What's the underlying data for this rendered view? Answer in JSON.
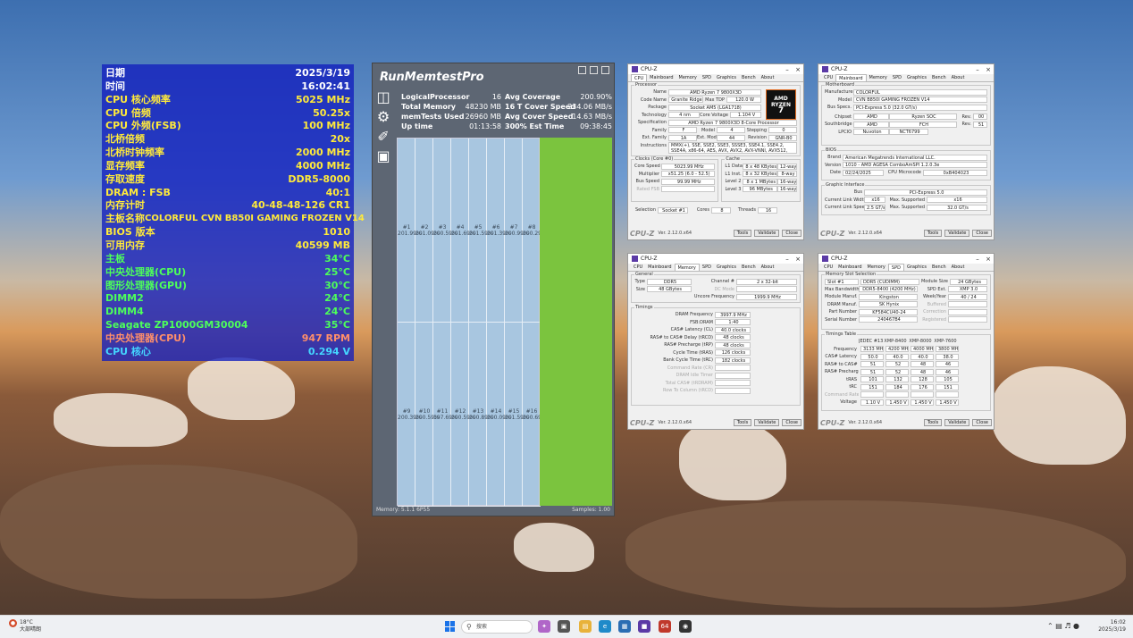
{
  "sensor_panel": {
    "rows": [
      {
        "label": "日期",
        "value": "2025/3/19",
        "color": "white"
      },
      {
        "label": "时间",
        "value": "16:02:41",
        "color": "white"
      },
      {
        "label": "CPU 核心频率",
        "value": "5025 MHz",
        "color": "yellow"
      },
      {
        "label": "CPU 倍频",
        "value": "50.25x",
        "color": "yellow"
      },
      {
        "label": "CPU 外频(FSB)",
        "value": "100 MHz",
        "color": "yellow"
      },
      {
        "label": "北桥倍频",
        "value": "20x",
        "color": "yellow"
      },
      {
        "label": "北桥时钟频率",
        "value": "2000 MHz",
        "color": "yellow"
      },
      {
        "label": "显存频率",
        "value": "4000 MHz",
        "color": "yellow"
      },
      {
        "label": "存取速度",
        "value": "DDR5-8000",
        "color": "yellow"
      },
      {
        "label": "DRAM : FSB",
        "value": "40:1",
        "color": "yellow"
      },
      {
        "label": "内存计时",
        "value": "40-48-48-126 CR1",
        "color": "yellow"
      },
      {
        "label": "主板名称",
        "value": "COLORFUL CVN B850I GAMING FROZEN V14",
        "color": "yellow"
      },
      {
        "label": "BIOS 版本",
        "value": "1010",
        "color": "yellow"
      },
      {
        "label": "可用内存",
        "value": "40599 MB",
        "color": "yellow"
      },
      {
        "label": "主板",
        "value": "34°C",
        "color": "green"
      },
      {
        "label": "中央处理器(CPU)",
        "value": "25°C",
        "color": "green"
      },
      {
        "label": "图形处理器(GPU)",
        "value": "30°C",
        "color": "green"
      },
      {
        "label": "DIMM2",
        "value": "24°C",
        "color": "green"
      },
      {
        "label": "DIMM4",
        "value": "24°C",
        "color": "green"
      },
      {
        "label": "Seagate ZP1000GM30004",
        "value": "35°C",
        "color": "green"
      },
      {
        "label": "中央处理器(CPU)",
        "value": "947 RPM",
        "color": "orange"
      },
      {
        "label": "CPU 核心",
        "value": "0.294 V",
        "color": "cyan"
      }
    ]
  },
  "runmemtest": {
    "title": "RunMemtestPro",
    "stats_left": [
      {
        "label": "LogicalProcessor",
        "value": "16"
      },
      {
        "label": "Total Memory",
        "value": "48230 MB"
      },
      {
        "label": "memTests Used",
        "value": "26960 MB"
      },
      {
        "label": "Up time",
        "value": "01:13:58"
      }
    ],
    "stats_right": [
      {
        "label": "Avg Coverage",
        "value": "200.90%"
      },
      {
        "label": "16 T Cover Speed",
        "value": "234.06 MB/s"
      },
      {
        "label": "Avg Cover Speed",
        "value": "14.63 MB/s"
      },
      {
        "label": "300% Est Time",
        "value": "09:38:45"
      }
    ],
    "cells_top": [
      {
        "id": "#1",
        "pct": "201.99%"
      },
      {
        "id": "#2",
        "pct": "201.09%"
      },
      {
        "id": "#3",
        "pct": "200.59%"
      },
      {
        "id": "#4",
        "pct": "201.69%"
      },
      {
        "id": "#5",
        "pct": "201.59%"
      },
      {
        "id": "#6",
        "pct": "201.39%"
      },
      {
        "id": "#7",
        "pct": "200.99%"
      },
      {
        "id": "#8",
        "pct": "200.29%"
      }
    ],
    "cells_bottom": [
      {
        "id": "#9",
        "pct": "200.39%"
      },
      {
        "id": "#10",
        "pct": "200.59%"
      },
      {
        "id": "#11",
        "pct": "197.69%"
      },
      {
        "id": "#12",
        "pct": "200.59%"
      },
      {
        "id": "#13",
        "pct": "200.89%"
      },
      {
        "id": "#14",
        "pct": "200.09%"
      },
      {
        "id": "#15",
        "pct": "201.59%"
      },
      {
        "id": "#16",
        "pct": "200.69%"
      }
    ],
    "footer_left": "Memory: 5.1.1 6P55",
    "footer_right": "Samples: 1.00"
  },
  "cpuz_common": {
    "title": "CPU-Z",
    "tabs": [
      "CPU",
      "Mainboard",
      "Memory",
      "SPD",
      "Graphics",
      "Bench",
      "About"
    ],
    "version": "Ver. 2.12.0.x64",
    "tools": "Tools",
    "validate": "Validate",
    "close": "Close"
  },
  "cpuz_cpu": {
    "processor_header": "Processor",
    "name": "AMD Ryzen 7 9800X3D",
    "code_name": "Granite Ridge",
    "max_tdp": "120.0 W",
    "package": "Socket AM5 (LGA1718)",
    "technology": "4 nm",
    "core_voltage": "1.104 V",
    "specification": "AMD Ryzen 7 9800X3D 8-Core Processor",
    "family": "F",
    "model": "4",
    "stepping": "0",
    "ext_family": "1A",
    "ext_model": "44",
    "revision": "GNR-B0",
    "instructions": "MMX(+), SSE, SSE2, SSE3, SSSE3, SSE4.1, SSE4.2, SSE4A, x86-64, AES, AVX, AVX2, AVX-VNNI, AVX512, FMA3, SHA",
    "clocks_header": "Clocks (Core #0)",
    "core_speed": "5023.99 MHz",
    "multiplier": "x51.25 (6.0 - 52.5)",
    "bus_speed": "99.99 MHz",
    "rated_fsb": "",
    "cache_header": "Cache",
    "l1_data": "8 x 48 KBytes",
    "l1_data_way": "12-way",
    "l1_inst": "8 x 32 KBytes",
    "l1_inst_way": "8-way",
    "level2": "8 x 1 MBytes",
    "level2_way": "16-way",
    "level3": "96 MBytes",
    "level3_way": "16-way",
    "selection": "Socket #1",
    "cores": "8",
    "threads": "16",
    "amd_logo_line1": "AMD",
    "amd_logo_line2": "RYZEN",
    "amd_logo_line3": "7"
  },
  "cpuz_mainboard": {
    "motherboard_header": "Motherboard",
    "manufacturer": "COLORFUL",
    "model": "CVN B850I GAMING FROZEN V14",
    "bus_specs": "PCI-Express 5.0 (32.0 GT/s)",
    "chipset": "AMD",
    "chipset_name": "Ryzen SOC",
    "chipset_rev": "00",
    "southbridge": "AMD",
    "southbridge_name": "FCH",
    "southbridge_rev": "51",
    "lpcio": "Nuvoton",
    "lpcio_name": "NCT6799",
    "bios_header": "BIOS",
    "brand": "American Megatrends International LLC.",
    "version": "1010 - AMD AGESA ComboAmSPI 1.2.0.3e",
    "date": "02/24/2025",
    "cpu_microcode": "0xB404023",
    "graphic_header": "Graphic Interface",
    "gi_bus": "PCI-Express 5.0",
    "link_width": "x16",
    "max_link_width": "x16",
    "link_speed": "2.5 GT/s",
    "max_link_speed": "32.0 GT/s"
  },
  "cpuz_memory": {
    "general_header": "General",
    "type": "DDR5",
    "channel": "2 x 32-bit",
    "size": "48 GBytes",
    "dc_mode": "",
    "uncore_frequency": "1999.9 MHz",
    "timings_header": "Timings",
    "dram_frequency": "3997.9 MHz",
    "fsb_dram": "1:40",
    "cas_latency": "40.0 clocks",
    "rcd": "48 clocks",
    "rp": "48 clocks",
    "ras": "126 clocks",
    "rc": "182 clocks"
  },
  "cpuz_spd": {
    "slot_header": "Memory Slot Selection",
    "slot": "Slot #1",
    "slot_type": "DDR5 (CUDIMM)",
    "module_size": "24 GBytes",
    "max_bandwidth": "DDR5-8400 (4200 MHz)",
    "spd_ext": "XMP 3.0",
    "module_manuf": "Kingston",
    "week_year": "40 / 24",
    "dram_manuf": "SK Hynix",
    "part_number": "KF584CU40-24",
    "serial_number": "240467B4",
    "timings_table_header": "Timings Table",
    "columns": [
      "JEDEC #13",
      "XMP-8400",
      "XMP-8000",
      "XMP-7600"
    ],
    "frequency": [
      "3133 MHz",
      "4200 MHz",
      "4000 MHz",
      "3800 MHz"
    ],
    "cas": [
      "50.0",
      "40.0",
      "40.0",
      "38.0"
    ],
    "ras_to_cas": [
      "51",
      "52",
      "48",
      "46"
    ],
    "ras_precharge": [
      "51",
      "52",
      "48",
      "46"
    ],
    "tras": [
      "101",
      "132",
      "128",
      "105"
    ],
    "trc": [
      "151",
      "184",
      "176",
      "151"
    ],
    "voltage": [
      "1.10 V",
      "1.450 V",
      "1.450 V",
      "1.450 V"
    ]
  },
  "taskbar": {
    "weather_temp": "18°C",
    "weather_desc": "大部晴朗",
    "search_placeholder": "搜索",
    "tb_app_64": "64",
    "clock_time": "16:02",
    "clock_date": "2025/3/19"
  }
}
